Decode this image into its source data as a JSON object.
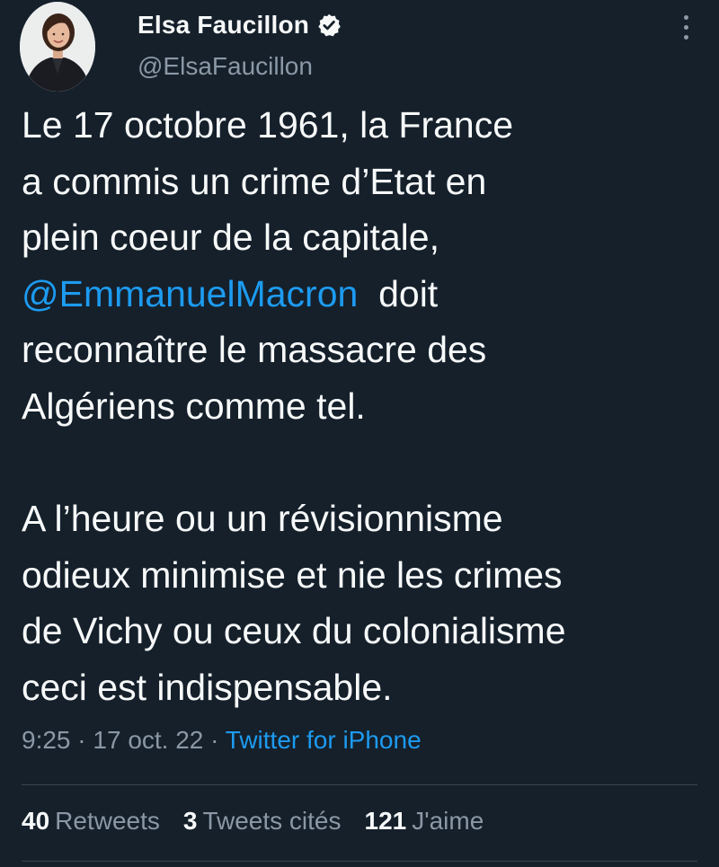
{
  "author": {
    "display_name": "Elsa Faucillon",
    "handle": "@ElsaFaucillon",
    "verified": true,
    "verified_icon": "verified-badge-icon",
    "avatar": "profile-photo"
  },
  "tweet": {
    "lines": [
      "Le 17 octobre 1961, la France",
      "a commis un crime d’Etat en",
      "plein coeur de la capitale,"
    ],
    "mention": "@EmmanuelMacron",
    "mention_tail": "  doit",
    "lines_after": [
      "reconnaître le massacre des",
      "Algériens comme tel."
    ],
    "paragraph2": [
      "A l’heure ou un révisionnisme",
      "odieux minimise et nie les crimes",
      "de Vichy ou ceux du colonialisme",
      "ceci est indispensable."
    ]
  },
  "meta": {
    "time": "9:25",
    "sep1": " · ",
    "date": "17 oct. 22",
    "sep2": " · ",
    "source": "Twitter for iPhone"
  },
  "stats": {
    "retweets_count": "40",
    "retweets_label": "Retweets",
    "quotes_count": "3",
    "quotes_label": "Tweets cités",
    "likes_count": "121",
    "likes_label": "J'aime"
  },
  "colors": {
    "background": "#15202b",
    "text": "#f7f9f9",
    "muted": "#8b98a5",
    "accent": "#1d9bf0",
    "divider": "#38444d"
  }
}
